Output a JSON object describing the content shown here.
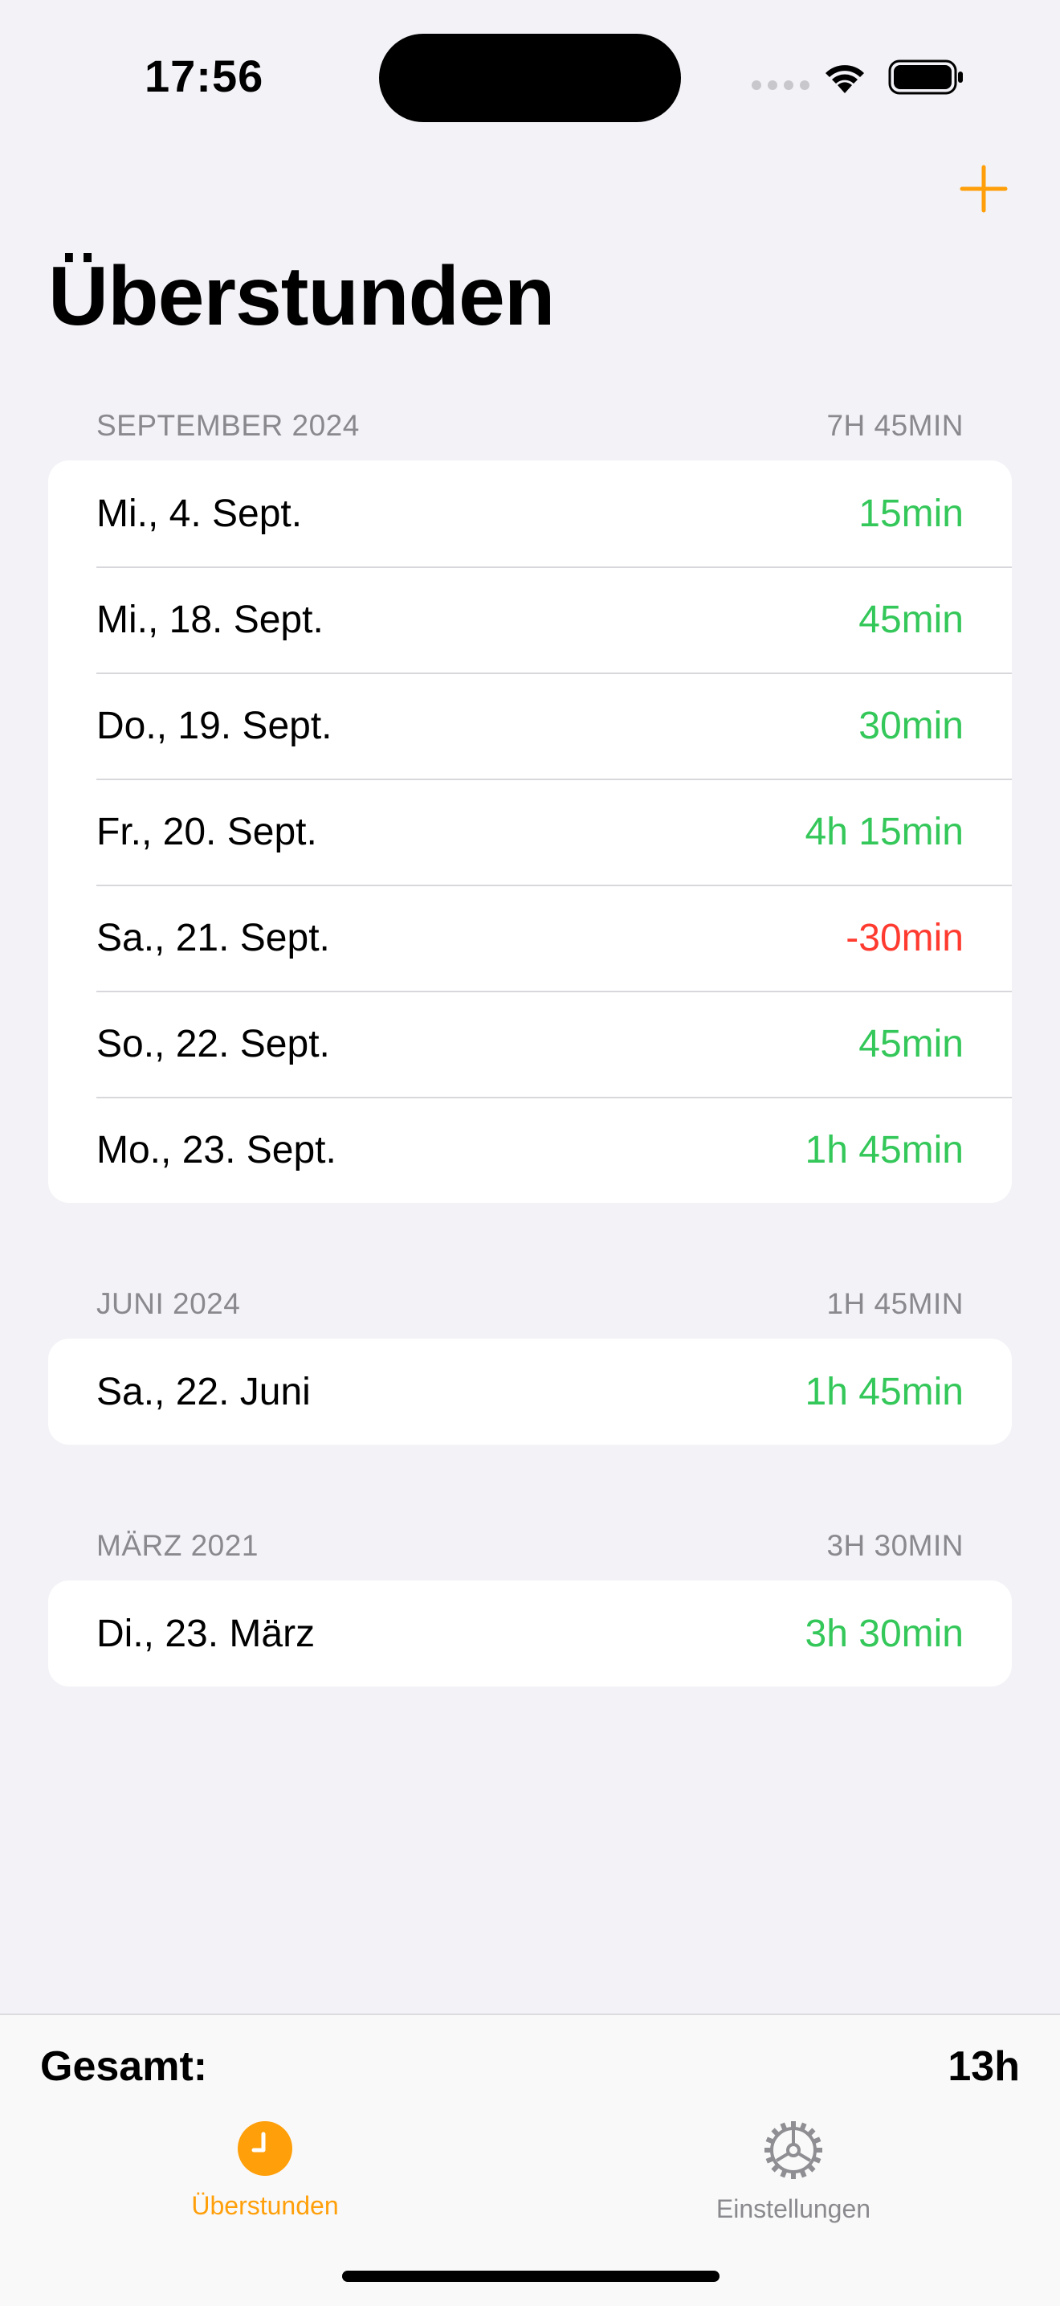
{
  "status_bar": {
    "time": "17:56"
  },
  "header": {
    "title": "Überstunden"
  },
  "colors": {
    "accent": "#ff9f0a",
    "positive": "#34c759",
    "negative": "#ff3b30",
    "secondary": "#8a8a8e"
  },
  "sections": [
    {
      "title": "SEPTEMBER 2024",
      "total": "7H 45MIN",
      "rows": [
        {
          "date": "Mi., 4. Sept.",
          "value": "15min"
        },
        {
          "date": "Mi., 18. Sept.",
          "value": "45min"
        },
        {
          "date": "Do., 19. Sept.",
          "value": "30min"
        },
        {
          "date": "Fr., 20. Sept.",
          "value": "4h 15min"
        },
        {
          "date": "Sa., 21. Sept.",
          "value": "-30min"
        },
        {
          "date": "So., 22. Sept.",
          "value": "45min"
        },
        {
          "date": "Mo., 23. Sept.",
          "value": "1h 45min"
        }
      ]
    },
    {
      "title": "JUNI 2024",
      "total": "1H 45MIN",
      "rows": [
        {
          "date": "Sa., 22. Juni",
          "value": "1h 45min"
        }
      ]
    },
    {
      "title": "MÄRZ 2021",
      "total": "3H 30MIN",
      "rows": [
        {
          "date": "Di., 23. März",
          "value": "3h 30min"
        }
      ]
    }
  ],
  "footer": {
    "total_label": "Gesamt:",
    "total_value": "13h"
  },
  "tab_bar": {
    "tabs": [
      {
        "label": "Überstunden",
        "icon": "clock-icon",
        "selected": true
      },
      {
        "label": "Einstellungen",
        "icon": "gear-icon",
        "selected": false
      }
    ]
  }
}
